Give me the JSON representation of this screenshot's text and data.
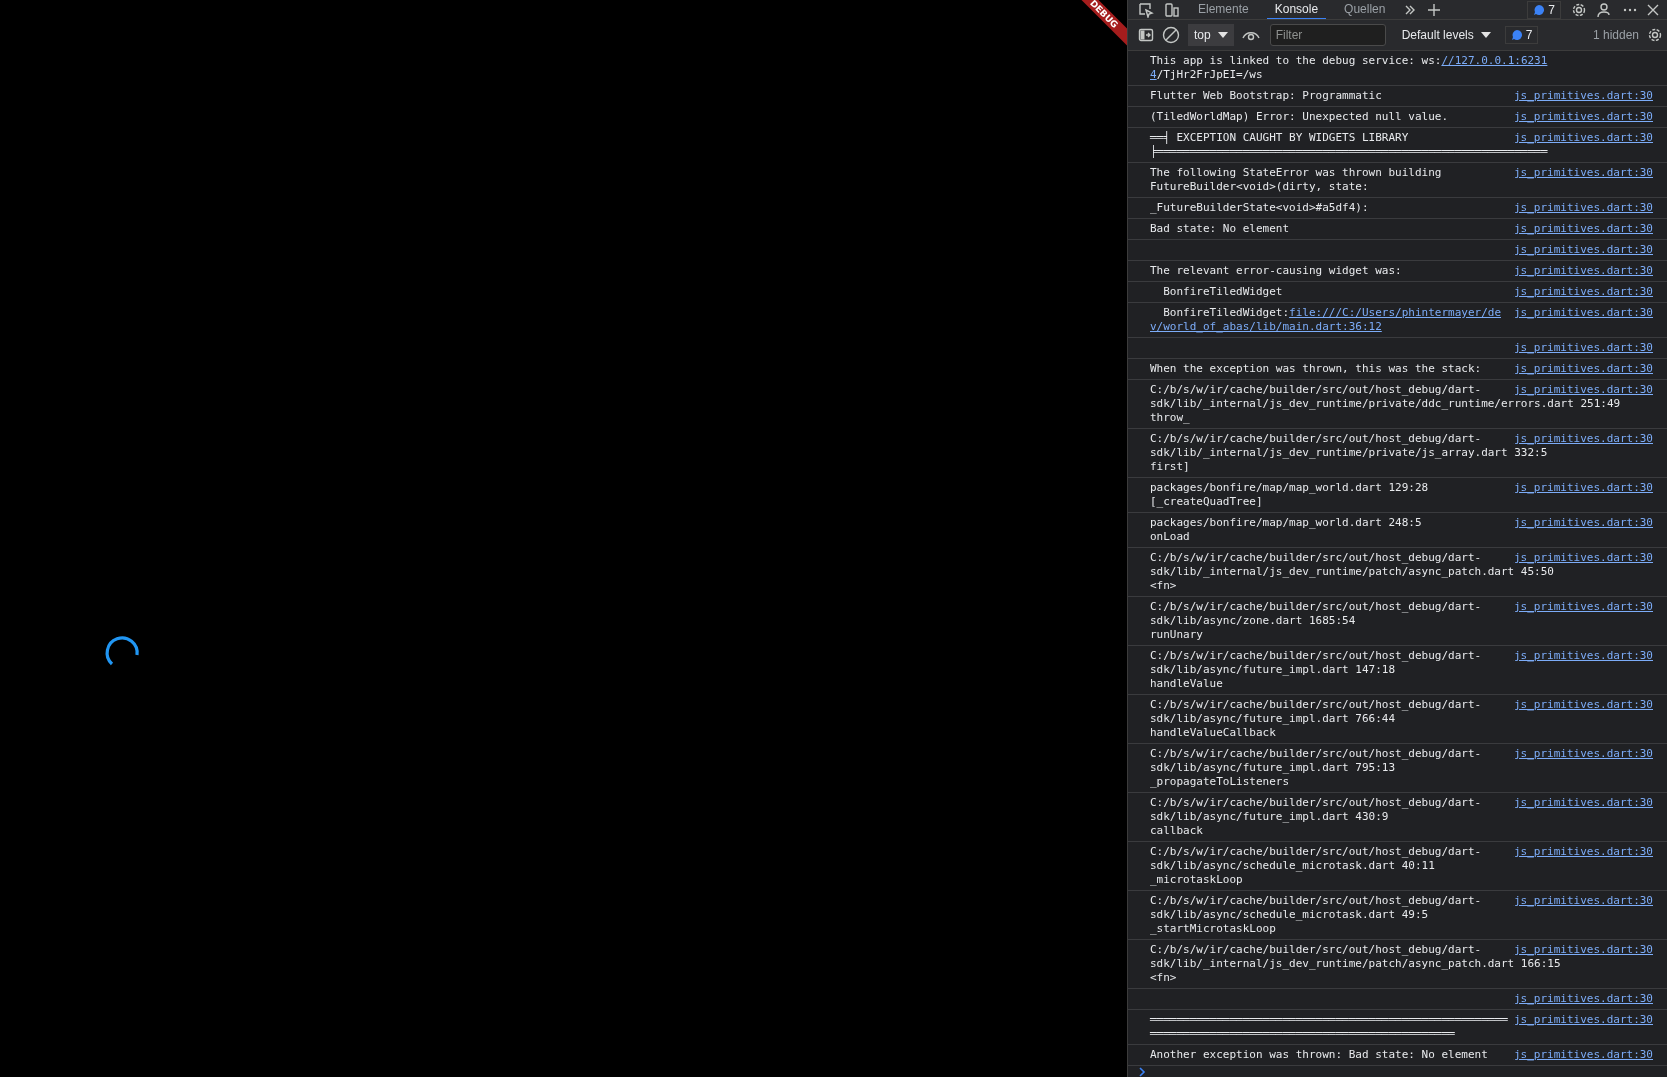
{
  "app": {
    "banner": "DEBUG",
    "loading": true
  },
  "devtools": {
    "tabs": [
      {
        "label": "Elemente",
        "selected": false
      },
      {
        "label": "Konsole",
        "selected": true
      },
      {
        "label": "Quellen",
        "selected": false
      }
    ],
    "issues_badge": "7"
  },
  "toolbar": {
    "context": "top",
    "filter_placeholder": "Filter",
    "levels": "Default levels",
    "messages_badge": "7",
    "hidden": "1 hidden"
  },
  "messages": [
    {
      "segments": [
        {
          "text": "This app is linked to the debug service: ws:",
          "link": false
        },
        {
          "text": "//127.0.0.1:6231\n4",
          "link": true
        },
        {
          "text": "/TjHr2FrJpEI=/ws",
          "link": false
        }
      ]
    },
    {
      "segments": [
        {
          "text": "Flutter Web Bootstrap: Programmatic",
          "link": false
        }
      ],
      "source": "js_primitives.dart:30"
    },
    {
      "segments": [
        {
          "text": "(TiledWorldMap) Error: Unexpected null value.",
          "link": false
        }
      ],
      "source": "js_primitives.dart:30"
    },
    {
      "segments": [
        {
          "text": "══╡ EXCEPTION CAUGHT BY WIDGETS LIBRARY\n╞═══════════════════════════════════════════════════════════",
          "link": false
        }
      ],
      "source": "js_primitives.dart:30"
    },
    {
      "segments": [
        {
          "text": "The following StateError was thrown building\nFutureBuilder<void>(dirty, state:",
          "link": false
        }
      ],
      "source": "js_primitives.dart:30"
    },
    {
      "segments": [
        {
          "text": "_FutureBuilderState<void>#a5df4):",
          "link": false
        }
      ],
      "source": "js_primitives.dart:30"
    },
    {
      "segments": [
        {
          "text": "Bad state: No element",
          "link": false
        }
      ],
      "source": "js_primitives.dart:30"
    },
    {
      "source": "js_primitives.dart:30"
    },
    {
      "segments": [
        {
          "text": "The relevant error-causing widget was:",
          "link": false
        }
      ],
      "source": "js_primitives.dart:30"
    },
    {
      "segments": [
        {
          "text": "  BonfireTiledWidget",
          "link": false
        }
      ],
      "source": "js_primitives.dart:30"
    },
    {
      "segments": [
        {
          "text": "  BonfireTiledWidget:",
          "link": false
        },
        {
          "text": "file:///C:/Users/phintermayer/de\nv/world_of_abas/lib/main.dart:36:12",
          "link": true
        }
      ],
      "source": "js_primitives.dart:30"
    },
    {
      "source": "js_primitives.dart:30"
    },
    {
      "segments": [
        {
          "text": "When the exception was thrown, this was the stack:",
          "link": false
        }
      ],
      "source": "js_primitives.dart:30"
    },
    {
      "segments": [
        {
          "text": "C:/b/s/w/ir/cache/builder/src/out/host_debug/dart-\nsdk/lib/_internal/js_dev_runtime/private/ddc_runtime/errors.dart 251:49\nthrow_",
          "link": false
        }
      ],
      "source": "js_primitives.dart:30"
    },
    {
      "segments": [
        {
          "text": "C:/b/s/w/ir/cache/builder/src/out/host_debug/dart-\nsdk/lib/_internal/js_dev_runtime/private/js_array.dart 332:5\nfirst]",
          "link": false
        }
      ],
      "source": "js_primitives.dart:30"
    },
    {
      "segments": [
        {
          "text": "packages/bonfire/map/map_world.dart 129:28\n[_createQuadTree]",
          "link": false
        }
      ],
      "source": "js_primitives.dart:30"
    },
    {
      "segments": [
        {
          "text": "packages/bonfire/map/map_world.dart 248:5\nonLoad",
          "link": false
        }
      ],
      "source": "js_primitives.dart:30"
    },
    {
      "segments": [
        {
          "text": "C:/b/s/w/ir/cache/builder/src/out/host_debug/dart-\nsdk/lib/_internal/js_dev_runtime/patch/async_patch.dart 45:50\n<fn>",
          "link": false
        }
      ],
      "source": "js_primitives.dart:30"
    },
    {
      "segments": [
        {
          "text": "C:/b/s/w/ir/cache/builder/src/out/host_debug/dart-\nsdk/lib/async/zone.dart 1685:54\nrunUnary",
          "link": false
        }
      ],
      "source": "js_primitives.dart:30"
    },
    {
      "segments": [
        {
          "text": "C:/b/s/w/ir/cache/builder/src/out/host_debug/dart-\nsdk/lib/async/future_impl.dart 147:18\nhandleValue",
          "link": false
        }
      ],
      "source": "js_primitives.dart:30"
    },
    {
      "segments": [
        {
          "text": "C:/b/s/w/ir/cache/builder/src/out/host_debug/dart-\nsdk/lib/async/future_impl.dart 766:44\nhandleValueCallback",
          "link": false
        }
      ],
      "source": "js_primitives.dart:30"
    },
    {
      "segments": [
        {
          "text": "C:/b/s/w/ir/cache/builder/src/out/host_debug/dart-\nsdk/lib/async/future_impl.dart 795:13\n_propagateToListeners",
          "link": false
        }
      ],
      "source": "js_primitives.dart:30"
    },
    {
      "segments": [
        {
          "text": "C:/b/s/w/ir/cache/builder/src/out/host_debug/dart-\nsdk/lib/async/future_impl.dart 430:9\ncallback",
          "link": false
        }
      ],
      "source": "js_primitives.dart:30"
    },
    {
      "segments": [
        {
          "text": "C:/b/s/w/ir/cache/builder/src/out/host_debug/dart-\nsdk/lib/async/schedule_microtask.dart 40:11\n_microtaskLoop",
          "link": false
        }
      ],
      "source": "js_primitives.dart:30"
    },
    {
      "segments": [
        {
          "text": "C:/b/s/w/ir/cache/builder/src/out/host_debug/dart-\nsdk/lib/async/schedule_microtask.dart 49:5\n_startMicrotaskLoop",
          "link": false
        }
      ],
      "source": "js_primitives.dart:30"
    },
    {
      "segments": [
        {
          "text": "C:/b/s/w/ir/cache/builder/src/out/host_debug/dart-\nsdk/lib/_internal/js_dev_runtime/patch/async_patch.dart 166:15\n<fn>",
          "link": false
        }
      ],
      "source": "js_primitives.dart:30"
    },
    {
      "source": "js_primitives.dart:30"
    },
    {
      "segments": [
        {
          "text": "══════════════════════════════════════════════════════\n══════════════════════════════════════════════",
          "link": false
        }
      ],
      "source": "js_primitives.dart:30"
    },
    {
      "segments": [
        {
          "text": "Another exception was thrown: Bad state: No element",
          "link": false
        }
      ],
      "source": "js_primitives.dart:30"
    }
  ]
}
